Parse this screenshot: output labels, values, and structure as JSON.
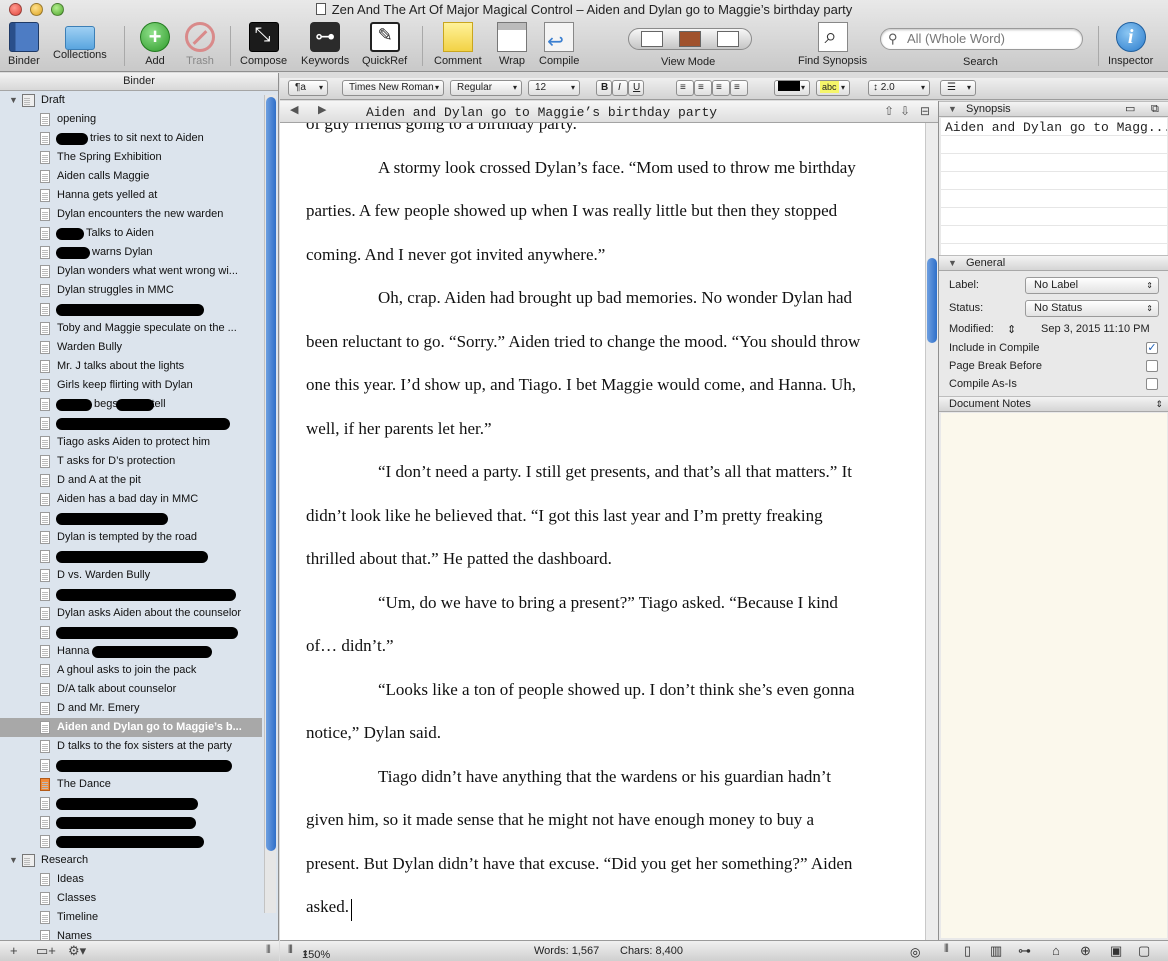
{
  "window": {
    "title": "Zen And The Art Of Major Magical Control – Aiden and Dylan go to Maggie’s birthday party"
  },
  "toolbar": {
    "binder": "Binder",
    "collections": "Collections",
    "add": "Add",
    "trash": "Trash",
    "compose": "Compose",
    "keywords": "Keywords",
    "quickref": "QuickRef",
    "comment": "Comment",
    "wrap": "Wrap",
    "compile": "Compile",
    "view_mode": "View Mode",
    "find_synopsis": "Find Synopsis",
    "search_placeholder": "All (Whole Word)",
    "search": "Search",
    "inspector": "Inspector"
  },
  "binder": {
    "header": "Binder",
    "draft_label": "Draft",
    "research_label": "Research",
    "items": [
      {
        "label": "opening",
        "redact": []
      },
      {
        "label": "tries to sit next to Aiden",
        "redact": [
          [
            56,
            32
          ]
        ]
      },
      {
        "label": "The Spring Exhibition",
        "redact": []
      },
      {
        "label": "Aiden calls Maggie",
        "redact": []
      },
      {
        "label": "Hanna gets yelled at",
        "redact": []
      },
      {
        "label": "Dylan encounters the new warden",
        "redact": []
      },
      {
        "label": "Talks to Aiden",
        "redact": [
          [
            56,
            28
          ]
        ]
      },
      {
        "label": "warns Dylan",
        "redact": [
          [
            56,
            34
          ]
        ]
      },
      {
        "label": "Dylan wonders what went wrong wi...",
        "redact": []
      },
      {
        "label": "Dylan struggles in MMC",
        "redact": []
      },
      {
        "label": "",
        "redact": [
          [
            56,
            148
          ]
        ]
      },
      {
        "label": "Toby and Maggie speculate on the ...",
        "redact": []
      },
      {
        "label": "Warden Bully",
        "redact": []
      },
      {
        "label": "Mr. J talks about the lights",
        "redact": []
      },
      {
        "label": "Girls keep flirting with Dylan",
        "redact": []
      },
      {
        "label": "begs not to tell",
        "redact": [
          [
            56,
            36
          ],
          [
            116,
            38
          ]
        ]
      },
      {
        "label": "",
        "redact": [
          [
            56,
            174
          ]
        ]
      },
      {
        "label": "Tiago asks Aiden to protect him",
        "redact": []
      },
      {
        "label": "T asks for D’s protection",
        "redact": []
      },
      {
        "label": "D and A at the pit",
        "redact": []
      },
      {
        "label": "Aiden has a bad day in MMC",
        "redact": []
      },
      {
        "label": "",
        "redact": [
          [
            56,
            112
          ]
        ]
      },
      {
        "label": "Dylan is tempted by the road",
        "redact": []
      },
      {
        "label": "",
        "redact": [
          [
            56,
            152
          ]
        ]
      },
      {
        "label": "D vs. Warden Bully",
        "redact": []
      },
      {
        "label": "",
        "redact": [
          [
            56,
            180
          ]
        ]
      },
      {
        "label": "Dylan asks Aiden about the counselor",
        "redact": []
      },
      {
        "label": "",
        "redact": [
          [
            56,
            182
          ]
        ]
      },
      {
        "label": "Hanna",
        "redact": [
          [
            92,
            120
          ]
        ]
      },
      {
        "label": "A ghoul asks to join the pack",
        "redact": []
      },
      {
        "label": "D/A talk about counselor",
        "redact": []
      },
      {
        "label": "D and Mr. Emery",
        "redact": []
      },
      {
        "label": "Aiden and Dylan go to Maggie’s b...",
        "redact": [],
        "selected": true
      },
      {
        "label": "D talks to the fox sisters at the party",
        "redact": []
      },
      {
        "label": "",
        "redact": [
          [
            56,
            176
          ]
        ]
      },
      {
        "label": "The Dance",
        "redact": [],
        "flag": true
      },
      {
        "label": "",
        "redact": [
          [
            56,
            142
          ]
        ]
      },
      {
        "label": "",
        "redact": [
          [
            56,
            140
          ]
        ]
      },
      {
        "label": "",
        "redact": [
          [
            56,
            148
          ]
        ]
      }
    ],
    "research_items": [
      "Ideas",
      "Classes",
      "Timeline",
      "Names"
    ]
  },
  "format_bar": {
    "paragraph": "¶a",
    "font": "Times New Roman",
    "style": "Regular",
    "size": "12",
    "bold": "B",
    "italic": "I",
    "underline": "U",
    "highlight": "abc",
    "line_spacing": "2.0"
  },
  "editor": {
    "doc_title": "Aiden and Dylan go to Maggie’s birthday party",
    "lines": [
      {
        "text": "of guy friends going to a birthday party.",
        "indent": false
      },
      {
        "text": "A stormy look crossed Dylan’s face. “Mom used to throw me birthday",
        "indent": true
      },
      {
        "text": "parties. A few people showed up when I was really little but then they stopped",
        "indent": false
      },
      {
        "text": "coming. And I never got invited anywhere.”",
        "indent": false
      },
      {
        "text": "Oh, crap. Aiden had brought up bad memories. No wonder Dylan had",
        "indent": true
      },
      {
        "text": "been reluctant to go. “Sorry.” Aiden tried to change the mood. “You should throw",
        "indent": false
      },
      {
        "text": "one this year. I’d show up, and Tiago. I bet Maggie would come, and Hanna. Uh,",
        "indent": false
      },
      {
        "text": "well, if her parents let her.”",
        "indent": false
      },
      {
        "text": "“I don’t need a party. I still get presents, and that’s all that matters.” It",
        "indent": true
      },
      {
        "text": "didn’t look like he believed that. “I got this last year and I’m pretty freaking",
        "indent": false
      },
      {
        "text": "thrilled about that.” He patted the dashboard.",
        "indent": false
      },
      {
        "text": "“Um, do we have to bring a present?” Tiago asked. “Because I kind",
        "indent": true
      },
      {
        "text": "of… didn’t.”",
        "indent": false
      },
      {
        "text": "“Looks like a ton of people showed up. I don’t think she’s even gonna",
        "indent": true
      },
      {
        "text": "notice,” Dylan said.",
        "indent": false
      },
      {
        "text": "Tiago didn’t have anything that the wardens or his guardian hadn’t",
        "indent": true
      },
      {
        "text": "given him, so it made sense that he might not have enough money to buy a",
        "indent": false
      },
      {
        "text": "present. But Dylan didn’t have that excuse. “Did you get her something?” Aiden",
        "indent": false
      },
      {
        "text": "asked.",
        "indent": false
      }
    ]
  },
  "inspector": {
    "synopsis_header": "Synopsis",
    "synopsis_text": "Aiden and Dylan go to Magg...",
    "general_header": "General",
    "label_label": "Label:",
    "label_value": "No Label",
    "status_label": "Status:",
    "status_value": "No Status",
    "modified_label": "Modified:",
    "modified_value": "Sep 3, 2015 11:10 PM",
    "include_compile": "Include in Compile",
    "page_break": "Page Break Before",
    "compile_as_is": "Compile As-Is",
    "notes_header": "Document Notes"
  },
  "footer": {
    "zoom": "150%",
    "words": "Words: 1,567",
    "chars": "Chars: 8,400"
  }
}
